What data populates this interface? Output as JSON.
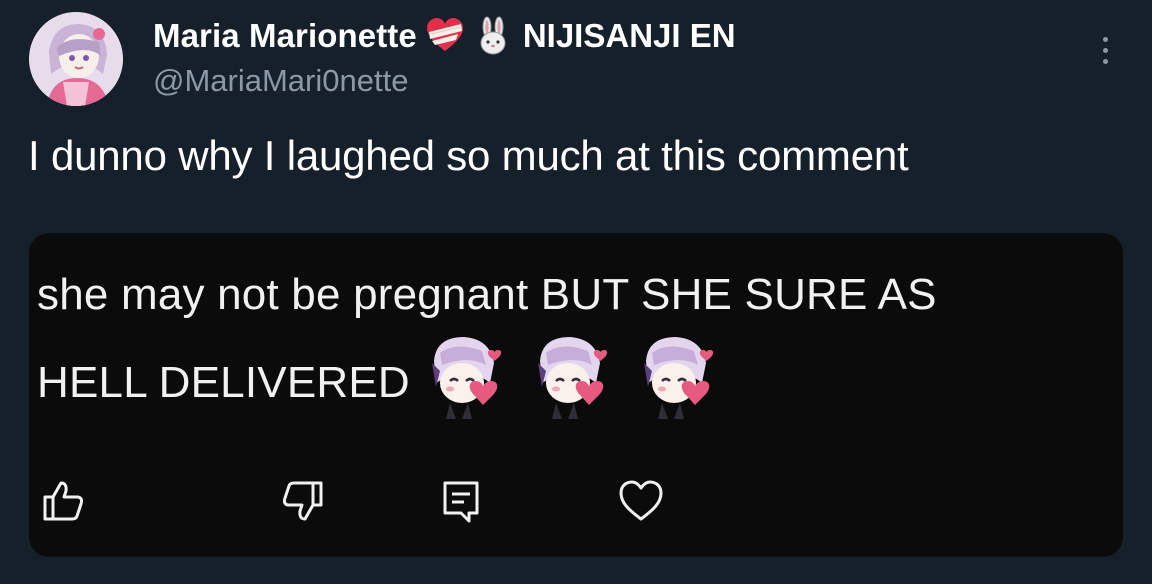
{
  "tweet": {
    "author": {
      "display_name": "Maria Marionette",
      "name_emojis": [
        "bandaged-heart-icon",
        "rabbit-icon"
      ],
      "organization": "NIJISANJI EN",
      "handle": "@MariaMari0nette"
    },
    "text": "I dunno why I laughed so much at this comment"
  },
  "comment": {
    "line1": "she may not be pregnant BUT SHE SURE AS",
    "line2": "HELL DELIVERED",
    "sticker_count": 3,
    "actions": [
      "thumbs-up-icon",
      "thumbs-down-icon",
      "reply-icon",
      "heart-icon"
    ]
  },
  "colors": {
    "background": "#15202b",
    "card": "#0b0b0c",
    "primary_text": "#ffffff",
    "secondary_text": "#8b98a5"
  }
}
